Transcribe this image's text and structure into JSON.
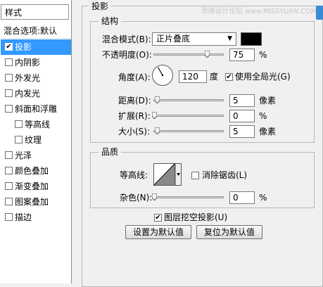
{
  "style_panel": {
    "header": "样式",
    "blend_defaults": "混合选项:默认",
    "items": [
      {
        "label": "投影",
        "checked": true,
        "active": true,
        "sub": false
      },
      {
        "label": "内阴影",
        "checked": false,
        "active": false,
        "sub": false
      },
      {
        "label": "外发光",
        "checked": false,
        "active": false,
        "sub": false
      },
      {
        "label": "内发光",
        "checked": false,
        "active": false,
        "sub": false
      },
      {
        "label": "斜面和浮雕",
        "checked": false,
        "active": false,
        "sub": false
      },
      {
        "label": "等高线",
        "checked": false,
        "active": false,
        "sub": true
      },
      {
        "label": "纹理",
        "checked": false,
        "active": false,
        "sub": true
      },
      {
        "label": "光泽",
        "checked": false,
        "active": false,
        "sub": false
      },
      {
        "label": "颜色叠加",
        "checked": false,
        "active": false,
        "sub": false
      },
      {
        "label": "渐变叠加",
        "checked": false,
        "active": false,
        "sub": false
      },
      {
        "label": "图案叠加",
        "checked": false,
        "active": false,
        "sub": false
      },
      {
        "label": "描边",
        "checked": false,
        "active": false,
        "sub": false
      }
    ]
  },
  "drop_shadow": {
    "title": "投影",
    "structure": {
      "title": "结构",
      "blend_mode_label": "混合模式(B):",
      "blend_mode_value": "正片叠底",
      "shadow_color": "#000000",
      "opacity_label": "不透明度(O):",
      "opacity_value": "75",
      "opacity_unit": "%",
      "opacity_fraction": 0.75,
      "angle_label": "角度(A):",
      "angle_value": "120",
      "angle_unit": "度",
      "angle_degrees": 120,
      "global_light_label": "使用全局光(G)",
      "global_light_checked": true,
      "distance_label": "距离(D):",
      "distance_value": "5",
      "distance_unit": "像素",
      "spread_label": "扩展(R):",
      "spread_value": "0",
      "spread_unit": "%",
      "size_label": "大小(S):",
      "size_value": "5",
      "size_unit": "像素"
    },
    "quality": {
      "title": "品质",
      "contour_label": "等高线:",
      "anti_alias_label": "消除锯齿(L)",
      "anti_alias_checked": false,
      "noise_label": "杂色(N):",
      "noise_value": "0",
      "noise_unit": "%"
    },
    "knockout_label": "图层挖空投影(U)",
    "knockout_checked": true,
    "set_default_label": "设置为默认值",
    "reset_default_label": "复位为默认值"
  },
  "watermark": "思缘设计论坛 www.MISSYUAN.COM"
}
